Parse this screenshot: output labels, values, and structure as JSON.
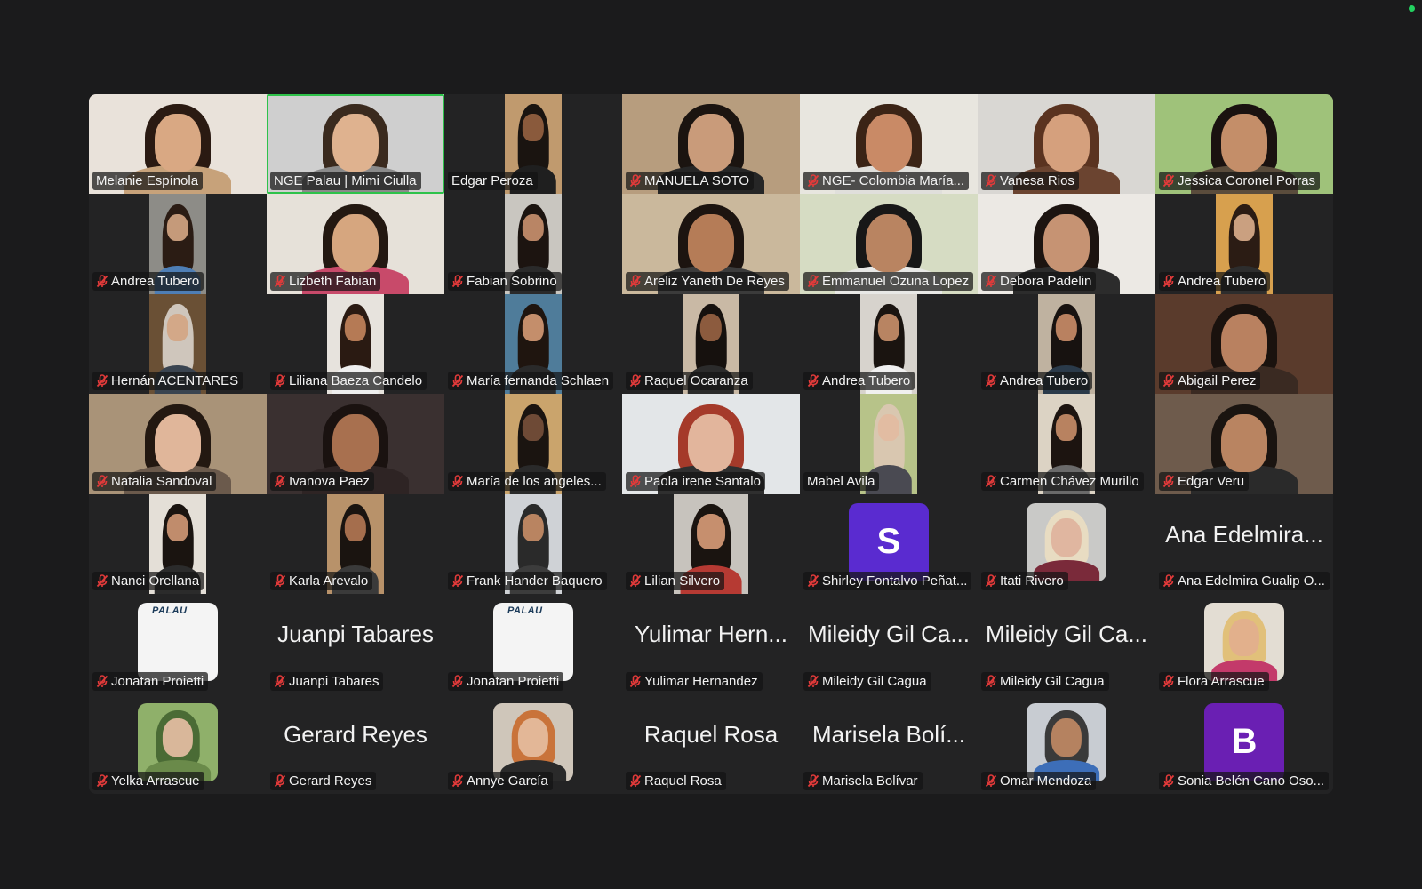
{
  "window": {
    "status_color": "#23d160"
  },
  "gallery": {
    "active_speaker_color": "#2ec24a",
    "participants": [
      {
        "name": "Melanie Espínola",
        "muted": false,
        "video": "full",
        "bg": "#e9e2da",
        "skin": "#d9a883",
        "hair": "#2a1a12",
        "shirt": "#c7a27a"
      },
      {
        "name": "NGE Palau | Mimi Ciulla",
        "muted": false,
        "video": "full",
        "bg": "#cfcfcf",
        "skin": "#dfb28f",
        "hair": "#3a2a1e",
        "shirt": "#8a8a8a",
        "active": true
      },
      {
        "name": "Edgar Peroza",
        "muted": false,
        "video": "half",
        "bg": "#c09a6e",
        "skin": "#8a5a3c",
        "hair": "#1a1410",
        "shirt": "#1f1f1f"
      },
      {
        "name": "MANUELA SOTO",
        "muted": true,
        "video": "full",
        "bg": "#b79d7e",
        "skin": "#c99b7a",
        "hair": "#1b1410",
        "shirt": "#262626"
      },
      {
        "name": "NGE- Colombia María...",
        "muted": true,
        "video": "full",
        "bg": "#e8e6df",
        "skin": "#c98a66",
        "hair": "#3b2416",
        "shirt": "#e0dfdb"
      },
      {
        "name": "Vanesa Rios",
        "muted": true,
        "video": "full",
        "bg": "#d9d7d3",
        "skin": "#d5a07d",
        "hair": "#5a3320",
        "shirt": "#6b4430"
      },
      {
        "name": "Jessica Coronel Porras",
        "muted": true,
        "video": "full",
        "bg": "#9fc27a",
        "skin": "#c48e69",
        "hair": "#1a1210",
        "shirt": "#5a4c3c"
      },
      {
        "name": "Andrea Tubero",
        "muted": true,
        "video": "half",
        "bg": "#8d8c87",
        "skin": "#c59a7a",
        "hair": "#2b1c14",
        "shirt": "#4e7eb5"
      },
      {
        "name": "Lizbeth Fabian",
        "muted": true,
        "video": "full",
        "bg": "#e6e1d9",
        "skin": "#d6a67f",
        "hair": "#231811",
        "shirt": "#c84a6a"
      },
      {
        "name": "Fabian Sobrino",
        "muted": true,
        "video": "half",
        "bg": "#c9c6c0",
        "skin": "#b98565",
        "hair": "#1c1410",
        "shirt": "#2a2a2a"
      },
      {
        "name": "Areliz Yaneth De Reyes",
        "muted": true,
        "video": "full",
        "bg": "#cab89c",
        "skin": "#b57c57",
        "hair": "#1c1410",
        "shirt": "#3b3b3b"
      },
      {
        "name": "Emmanuel Ozuna Lopez",
        "muted": true,
        "video": "full",
        "bg": "#d6dcc3",
        "skin": "#b98461",
        "hair": "#171717",
        "shirt": "#e8e8e6"
      },
      {
        "name": "Debora Padelin",
        "muted": true,
        "video": "full",
        "bg": "#ece9e4",
        "skin": "#c69373",
        "hair": "#1c1410",
        "shirt": "#2c2c2c"
      },
      {
        "name": "Andrea Tubero",
        "muted": true,
        "video": "half",
        "bg": "#d7a04e",
        "skin": "#caa080",
        "hair": "#2b1c14",
        "shirt": "#2d2d2d"
      },
      {
        "name": "Hernán ACENTARES",
        "muted": true,
        "video": "half",
        "bg": "#6a5035",
        "skin": "#d3a888",
        "hair": "#cfc6bc",
        "shirt": "#3a4450"
      },
      {
        "name": "Liliana Baeza Candelo",
        "muted": true,
        "video": "half",
        "bg": "#e7e3dd",
        "skin": "#b57a55",
        "hair": "#2a1a12",
        "shirt": "#efefef"
      },
      {
        "name": "María fernanda Schlaen",
        "muted": true,
        "video": "half",
        "bg": "#4f7c9a",
        "skin": "#c48e6b",
        "hair": "#1f150f",
        "shirt": "#2a2a2a"
      },
      {
        "name": "Raquel Ocaranza",
        "muted": true,
        "video": "half",
        "bg": "#c9b9a5",
        "skin": "#8c5b3e",
        "hair": "#16110e",
        "shirt": "#2b2b2b"
      },
      {
        "name": "Andrea Tubero",
        "muted": true,
        "video": "half",
        "bg": "#d7d3cd",
        "skin": "#b88462",
        "hair": "#1a1410",
        "shirt": "#f0f0f0"
      },
      {
        "name": "Andrea Tubero",
        "muted": true,
        "video": "half",
        "bg": "#bfb2a0",
        "skin": "#b98160",
        "hair": "#171210",
        "shirt": "#2a3a4a"
      },
      {
        "name": "Abigail Perez",
        "muted": true,
        "video": "full",
        "bg": "#5a3b2c",
        "skin": "#b98160",
        "hair": "#1a120e",
        "shirt": "#3a2a22"
      },
      {
        "name": "Natalia Sandoval",
        "muted": true,
        "video": "full",
        "bg": "#a99378",
        "skin": "#e0b69a",
        "hair": "#231811",
        "shirt": "#6b5a4c"
      },
      {
        "name": "Ivanova Paez",
        "muted": true,
        "video": "full",
        "bg": "#3a3030",
        "skin": "#a8704f",
        "hair": "#1a1210",
        "shirt": "#2e2424"
      },
      {
        "name": "María de los angeles...",
        "muted": true,
        "video": "half",
        "bg": "#caa46c",
        "skin": "#6e4a36",
        "hair": "#1a1410",
        "shirt": "#2a2a2a"
      },
      {
        "name": "Paola irene Santalo",
        "muted": true,
        "video": "full",
        "bg": "#e3e6e8",
        "skin": "#e2b59c",
        "hair": "#a53a2a",
        "shirt": "#2f2f2f"
      },
      {
        "name": "Mabel Avila",
        "muted": false,
        "video": "half",
        "bg": "#b7c389",
        "skin": "#e2bca2",
        "hair": "#d9c7b0",
        "shirt": "#4a4a52"
      },
      {
        "name": "Carmen Chávez Murillo",
        "muted": true,
        "video": "half",
        "bg": "#dcd3c4",
        "skin": "#b88260",
        "hair": "#1c1410",
        "shirt": "#6a6a6a"
      },
      {
        "name": "Edgar Veru",
        "muted": true,
        "video": "full",
        "bg": "#6e5b4c",
        "skin": "#b98461",
        "hair": "#1a1410",
        "shirt": "#2a2a2a"
      },
      {
        "name": "Nanci Orellana",
        "muted": true,
        "video": "half",
        "bg": "#e4dfd7",
        "skin": "#c08c6c",
        "hair": "#1a1410",
        "shirt": "#2b2b2b"
      },
      {
        "name": "Karla Arevalo",
        "muted": true,
        "video": "half",
        "bg": "#b8926a",
        "skin": "#a56e4d",
        "hair": "#1a1410",
        "shirt": "#3a3a3a"
      },
      {
        "name": "Frank Hander Baquero",
        "muted": true,
        "video": "half",
        "bg": "#cfd2d6",
        "skin": "#b98461",
        "hair": "#2a2a2a",
        "shirt": "#3c3c3c"
      },
      {
        "name": "Lilian Silvero",
        "muted": true,
        "video": "mid",
        "bg": "#c7c3bd",
        "skin": "#c68f6e",
        "hair": "#1a1410",
        "shirt": "#b63a33"
      },
      {
        "name": "Shirley Fontalvo Peñat...",
        "muted": true,
        "avatar": "letter",
        "letter": "S",
        "avatar_color": "#5a2bd0"
      },
      {
        "name": "Itati Rivero",
        "muted": true,
        "avatar": "photo",
        "bg": "#c9c9c7",
        "skin": "#e0b6a0",
        "hair": "#e8dcc2",
        "shirt": "#7a2a3a"
      },
      {
        "name": "Ana Edelmira Gualip O...",
        "muted": true,
        "avatar": "text",
        "display": "Ana Edelmira..."
      },
      {
        "name": "Jonatan Proietti",
        "muted": true,
        "avatar": "logo",
        "logo_text": "PALAU"
      },
      {
        "name": "Juanpi Tabares",
        "muted": true,
        "avatar": "text",
        "display": "Juanpi Tabares"
      },
      {
        "name": "Jonatan Proietti",
        "muted": true,
        "avatar": "logo",
        "logo_text": "PALAU"
      },
      {
        "name": "Yulimar Hernandez",
        "muted": true,
        "avatar": "text",
        "display": "Yulimar Hern..."
      },
      {
        "name": "Mileidy Gil Cagua",
        "muted": true,
        "avatar": "text",
        "display": "Mileidy Gil Ca..."
      },
      {
        "name": "Mileidy Gil Cagua",
        "muted": true,
        "avatar": "text",
        "display": "Mileidy Gil Ca..."
      },
      {
        "name": "Flora Arrascue",
        "muted": true,
        "avatar": "photo",
        "bg": "#e3ddd3",
        "skin": "#e2b08c",
        "hair": "#e1c07a",
        "shirt": "#c33a6a"
      },
      {
        "name": "Yelka Arrascue",
        "muted": true,
        "avatar": "photo",
        "bg": "#8fb06a",
        "skin": "#d9b79a",
        "hair": "#4a6b35",
        "shirt": "#6a8a4a"
      },
      {
        "name": "Gerard Reyes",
        "muted": true,
        "avatar": "text",
        "display": "Gerard Reyes"
      },
      {
        "name": "Annye García",
        "muted": true,
        "avatar": "photo",
        "bg": "#cfc6ba",
        "skin": "#e3b797",
        "hair": "#c9733a",
        "shirt": "#2a2a2a"
      },
      {
        "name": "Raquel Rosa",
        "muted": true,
        "avatar": "text",
        "display": "Raquel Rosa"
      },
      {
        "name": "Marisela Bolívar",
        "muted": true,
        "avatar": "text",
        "display": "Marisela Bolí..."
      },
      {
        "name": "Omar Mendoza",
        "muted": true,
        "avatar": "photo",
        "bg": "#c8ccd2",
        "skin": "#b58260",
        "hair": "#3a3a3a",
        "shirt": "#3d6eb8"
      },
      {
        "name": "Sonia Belén Cano Oso...",
        "muted": true,
        "avatar": "letter",
        "letter": "B",
        "avatar_color": "#6a1fb3"
      }
    ]
  }
}
